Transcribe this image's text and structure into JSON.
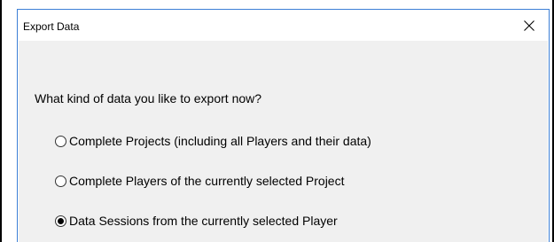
{
  "dialog": {
    "title": "Export Data",
    "close_glyph": "close-icon",
    "question": "What kind of data you like to export now?",
    "options": [
      {
        "label": "Complete Projects (including all Players and their data)",
        "checked": false
      },
      {
        "label": "Complete Players of the currently selected Project",
        "checked": false
      },
      {
        "label": "Data Sessions from the currently selected Player",
        "checked": true
      }
    ]
  },
  "colors": {
    "dialog_border": "#3c7fd6",
    "content_bg": "#f0f0f0",
    "outer_border": "#000000"
  }
}
